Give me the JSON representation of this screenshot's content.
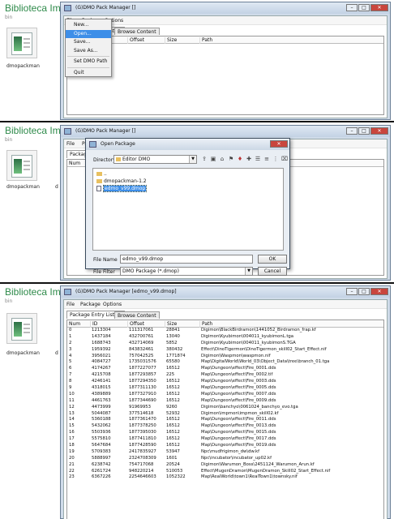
{
  "library": {
    "title": "Biblioteca Imagens",
    "path": "bin",
    "thumb_label": "dmopackman",
    "folder_label": "d"
  },
  "app": {
    "title_initial": "(G)DMO Pack Manager []",
    "title_loaded": "(G)DMO Pack Manager [edmo_v99.dmop]"
  },
  "menu": {
    "file": "File",
    "package": "Package",
    "options": "Options"
  },
  "file_menu": {
    "items": [
      "New...",
      "Open...",
      "Save...",
      "Save As...",
      "Set DMO Path",
      "Quit"
    ],
    "highlighted": "Open..."
  },
  "tabs": {
    "listing": "Package Entry Listing",
    "browse": "Browse Content"
  },
  "columns": {
    "num": "Num",
    "id": "ID",
    "offset": "Offset",
    "size": "Size",
    "path": "Path"
  },
  "dialog": {
    "title": "Open Package",
    "directory_label": "Directory:",
    "directory_value": "Editor DMO",
    "items": [
      "..",
      "dmopackman-1.2",
      "edmo_v99.dmop"
    ],
    "selected": "edmo_v99.dmop",
    "file_name_label": "File Name",
    "file_name_value": "edmo_v99.dmop",
    "file_filter_label": "File Filter",
    "file_filter_value": "DMO Package (*.dmop)",
    "ok": "OK",
    "cancel": "Cancel"
  },
  "rows": [
    [
      "0",
      "1213304",
      "111317061",
      "28841",
      "Digimon\\BlackBirdramon\\1441052_Birdramon_frap.kf"
    ],
    [
      "1",
      "1437184",
      "432700761",
      "13040",
      "Digimon\\Kyubimon\\004011_kyubimonL.tga"
    ],
    [
      "2",
      "1688743",
      "432714069",
      "5852",
      "Digimon\\Kyubimon\\004011_kyubimonS.TGA"
    ],
    [
      "3",
      "1959392",
      "843832461",
      "380432",
      "Effect\\DinoTigermon\\DinoTigermon_skill02_Start_Effect.nif"
    ],
    [
      "4",
      "3956021",
      "757042525",
      "1771874",
      "Digimon\\Waspmon\\waspmon.nif"
    ],
    [
      "5",
      "4084727",
      "1735031576",
      "65580",
      "Map\\DigitalWorld\\World_03\\Object_Data\\tree\\branch_01.tga"
    ],
    [
      "6",
      "4174267",
      "1877227077",
      "16512",
      "Map\\Dungeon\\effect\\Fire_0001.dds"
    ],
    [
      "7",
      "4215708",
      "1877293857",
      "225",
      "Map\\Dungeon\\effect\\Fire_0002.tif"
    ],
    [
      "8",
      "4246141",
      "1877294350",
      "16512",
      "Map\\Dungeon\\effect\\Fire_0003.dds"
    ],
    [
      "9",
      "4318015",
      "1877311130",
      "16512",
      "Map\\Dungeon\\effect\\Fire_0005.dds"
    ],
    [
      "10",
      "4389889",
      "1877327910",
      "16512",
      "Map\\Dungeon\\effect\\Fire_0007.dds"
    ],
    [
      "11",
      "4461763",
      "1877344690",
      "16512",
      "Map\\Dungeon\\effect\\Fire_0009.dds"
    ],
    [
      "12",
      "4473999",
      "91969953",
      "9260",
      "Digimon\\banchyo\\0061024_banchyo_evo.tga"
    ],
    [
      "13",
      "5044087",
      "377514618",
      "52932",
      "Digimon\\impmon\\impmon_skill02.kf"
    ],
    [
      "14",
      "5360188",
      "1877361470",
      "16512",
      "Map\\Dungeon\\effect\\Fire_0011.dds"
    ],
    [
      "15",
      "5432062",
      "1877378250",
      "16512",
      "Map\\Dungeon\\effect\\Fire_0013.dds"
    ],
    [
      "16",
      "5503936",
      "1877395030",
      "16512",
      "Map\\Dungeon\\effect\\Fire_0015.dds"
    ],
    [
      "17",
      "5575810",
      "1877411810",
      "16512",
      "Map\\Dungeon\\effect\\Fire_0017.dds"
    ],
    [
      "18",
      "5647684",
      "1877428590",
      "16512",
      "Map\\Dungeon\\effect\\Fire_0019.dds"
    ],
    [
      "19",
      "5709383",
      "2417835927",
      "53947",
      "Npc\\mudfrigimon_dw\\dw.kf"
    ],
    [
      "20",
      "5888997",
      "2324708309",
      "1601",
      "Npc\\incubator\\incubator_up02.kf"
    ],
    [
      "21",
      "6238742",
      "754717068",
      "20524",
      "Digimon\\Warumon_Boss\\2451124_Warumon_Arun.kf"
    ],
    [
      "22",
      "6261724",
      "948220214",
      "510053",
      "Effect\\MugenDramon\\MugenDramon_Skill02_Start_Effect.nif"
    ],
    [
      "23",
      "6367226",
      "2254646603",
      "1052322",
      "Map\\RealWorld\\town1\\RealTown1\\townsky.nif"
    ]
  ]
}
